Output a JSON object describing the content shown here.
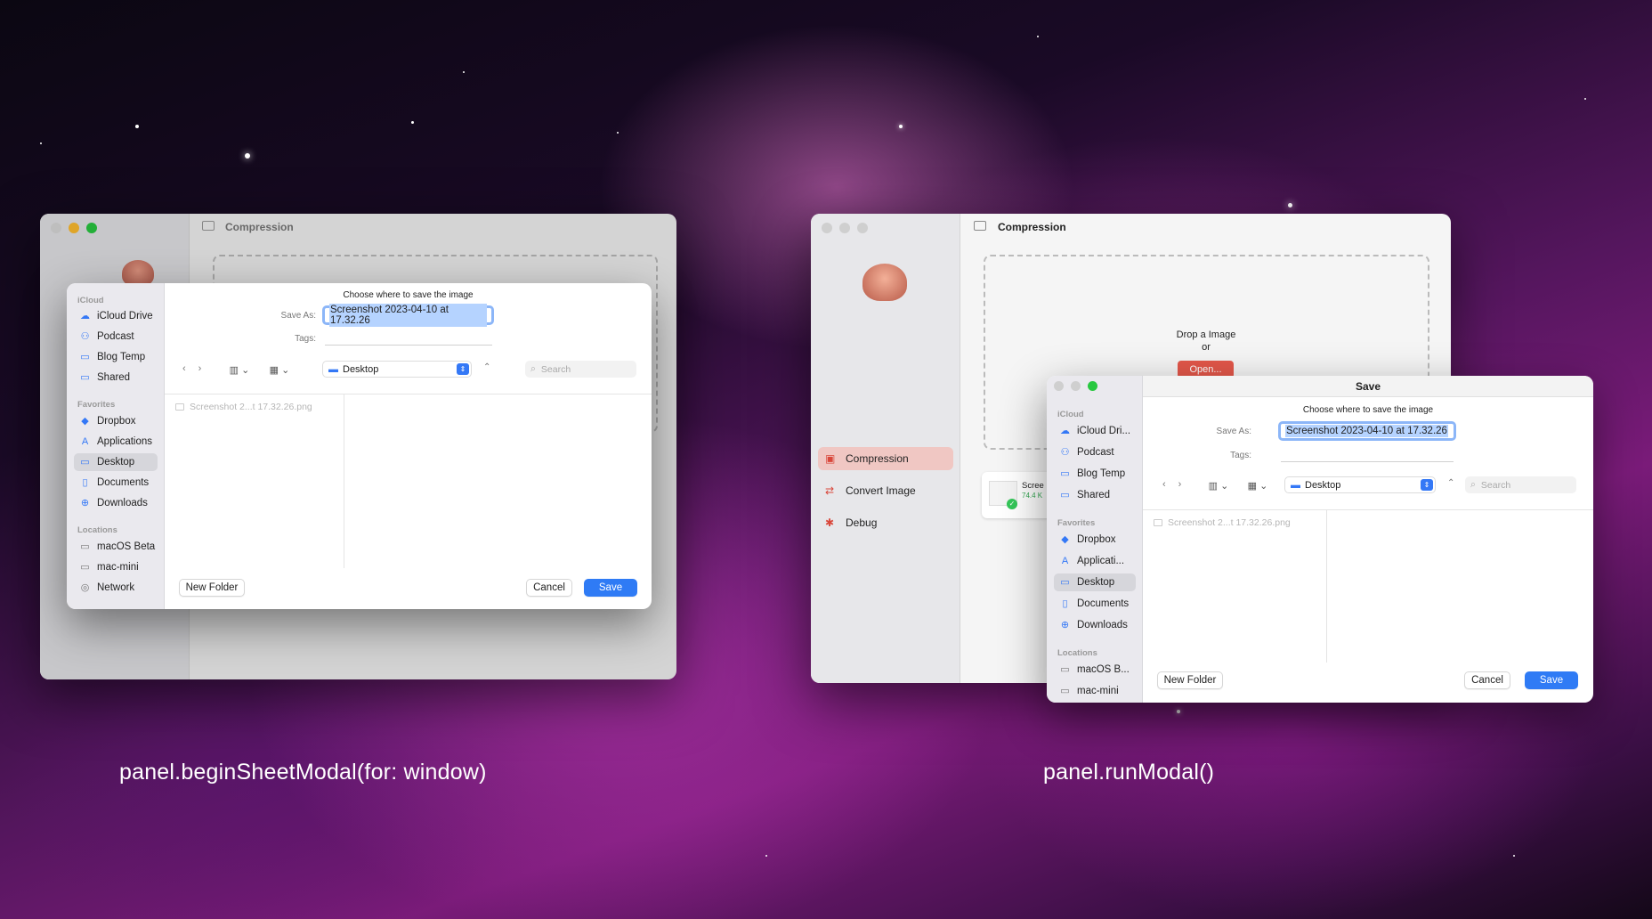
{
  "captions": {
    "left": "panel.beginSheetModal(for: window)",
    "right": "panel.runModal()"
  },
  "app": {
    "title": "Compression",
    "drop_text": "Drop a Image",
    "or_text": "or",
    "open_button": "Open...",
    "nav": [
      "Compression",
      "Convert Image",
      "Debug"
    ],
    "thumb_label": "Scree",
    "thumb_size": "74.4 K"
  },
  "panel": {
    "window_title": "Save",
    "prompt": "Choose where to save the image",
    "save_as_label": "Save As:",
    "save_as_value": "Screenshot 2023-04-10 at 17.32.26",
    "tags_label": "Tags:",
    "location": "Desktop",
    "search_placeholder": "Search",
    "file_name": "Screenshot 2...t 17.32.26.png",
    "new_folder": "New Folder",
    "cancel": "Cancel",
    "save": "Save"
  },
  "sidebar_left": {
    "icloud_header": "iCloud",
    "icloud": [
      "iCloud Drive",
      "Podcast",
      "Blog Temp",
      "Shared"
    ],
    "favorites_header": "Favorites",
    "favorites": [
      "Dropbox",
      "Applications",
      "Desktop",
      "Documents",
      "Downloads"
    ],
    "locations_header": "Locations",
    "locations": [
      "macOS Beta",
      "mac-mini",
      "Network"
    ]
  },
  "sidebar_right": {
    "icloud_header": "iCloud",
    "icloud": [
      "iCloud Dri...",
      "Podcast",
      "Blog Temp",
      "Shared"
    ],
    "favorites_header": "Favorites",
    "favorites": [
      "Dropbox",
      "Applicati...",
      "Desktop",
      "Documents",
      "Downloads"
    ],
    "locations_header": "Locations",
    "locations": [
      "macOS B...",
      "mac-mini"
    ]
  },
  "colors": {
    "accent": "#2f7bf5",
    "app_red": "#e3574a",
    "traffic_close": "#ff5f57",
    "traffic_min": "#febc2e",
    "traffic_max": "#28c840"
  },
  "icons": [
    "cloud-icon",
    "podcast-icon",
    "folder-icon",
    "shared-folder-icon",
    "dropbox-icon",
    "applications-icon",
    "desktop-icon",
    "document-icon",
    "downloads-icon",
    "disk-icon",
    "display-icon",
    "network-icon",
    "search-icon",
    "chevron-left-icon",
    "chevron-right-icon",
    "column-view-icon",
    "grid-view-icon",
    "chevron-up-icon",
    "sidebar-toggle-icon",
    "elephant-logo-icon"
  ]
}
